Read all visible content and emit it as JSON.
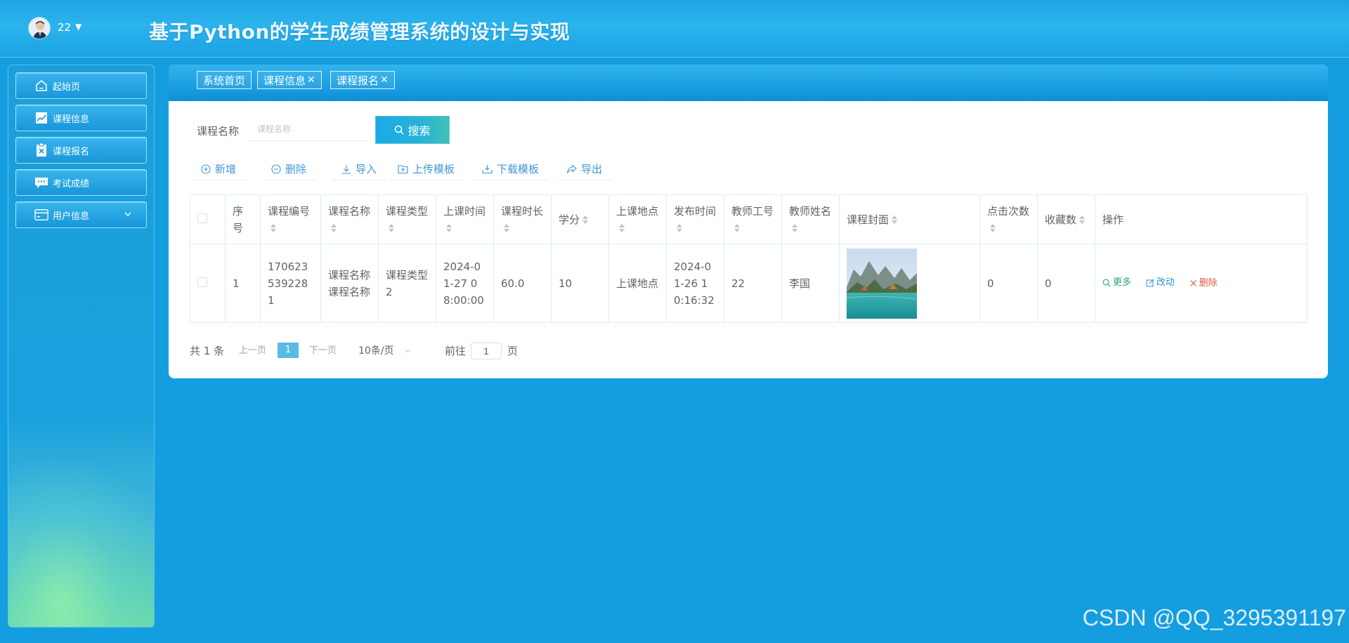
{
  "header": {
    "user_name": "22",
    "title": "基于Python的学生成绩管理系统的设计与实现"
  },
  "sidebar": {
    "items": [
      {
        "label": "起始页",
        "icon": "home-icon"
      },
      {
        "label": "课程信息",
        "icon": "chart-line-icon"
      },
      {
        "label": "课程报名",
        "icon": "clipboard-icon"
      },
      {
        "label": "考试成绩",
        "icon": "chat-icon"
      },
      {
        "label": "用户信息",
        "icon": "card-icon"
      }
    ]
  },
  "tabs": [
    {
      "label": "系统首页",
      "closable": false
    },
    {
      "label": "课程信息",
      "closable": true
    },
    {
      "label": "课程报名",
      "closable": true
    }
  ],
  "tab_close_glyph": "✕",
  "search": {
    "label": "课程名称",
    "placeholder": "课程名称",
    "button_label": "搜索"
  },
  "toolbar": {
    "add": "新增",
    "delete": "删除",
    "import": "导入",
    "upload_template": "上传模板",
    "download_template": "下载模板",
    "export": "导出"
  },
  "table": {
    "headers": {
      "index": "序号",
      "course_no": "课程编号",
      "course_name": "课程名称",
      "course_type": "课程类型",
      "class_time": "上课时间",
      "duration": "课程时长",
      "credit": "学分",
      "location": "上课地点",
      "publish_time": "发布时间",
      "teacher_no": "教师工号",
      "teacher_name": "教师姓名",
      "cover": "课程封面",
      "clicks": "点击次数",
      "favorites": "收藏数",
      "actions": "操作"
    },
    "rows": [
      {
        "index": "1",
        "course_no": "1706235392281",
        "course_name": "课程名称课程名称",
        "course_type": "课程类型2",
        "class_time": "2024-01-27 08:00:00",
        "duration": "60.0",
        "credit": "10",
        "location": "上课地点",
        "publish_time": "2024-01-26 10:16:32",
        "teacher_no": "22",
        "teacher_name": "李国",
        "clicks": "0",
        "favorites": "0",
        "actions": {
          "more": "更多",
          "edit": "改动",
          "delete": "删除"
        }
      }
    ]
  },
  "pagination": {
    "total": "共 1 条",
    "prev": "上一页",
    "current": "1",
    "next": "下一页",
    "page_size": "10条/页",
    "goto_label": "前往",
    "goto_value": "1",
    "goto_suffix": "页"
  },
  "watermark": "CSDN @QQ_3295391197",
  "colors": {
    "primary": "#149ee0",
    "link": "#4097d6",
    "more": "#2aa080",
    "delete": "#e05a3c"
  }
}
